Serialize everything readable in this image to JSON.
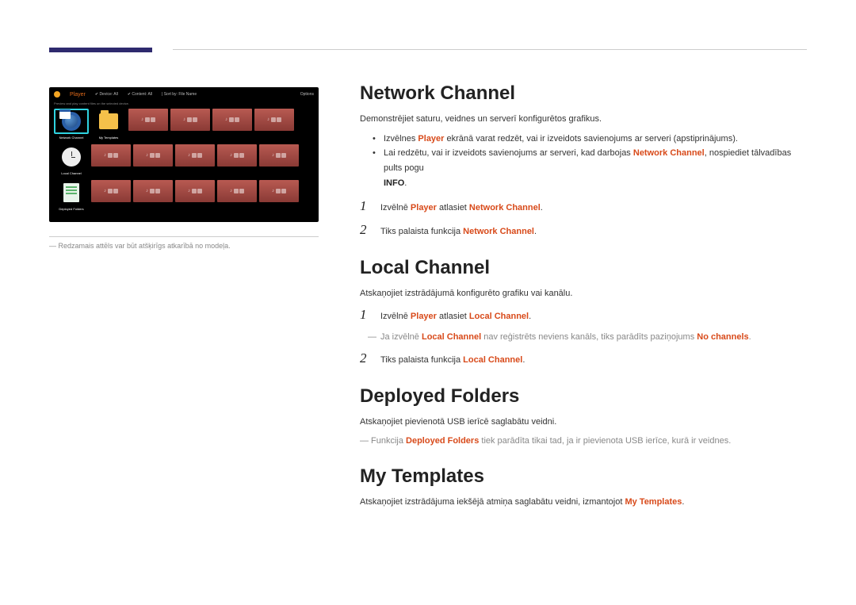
{
  "player_ui": {
    "title": "Player",
    "filter_device_label": "Device",
    "filter_device_value": "All",
    "filter_content_label": "Content",
    "filter_content_value": "All",
    "sort_label": "Sort by",
    "sort_value": "File Name",
    "options": "Options",
    "subtitle": "Preview and play content files on the selected device.",
    "tiles": {
      "network_channel": "Network Channel",
      "my_templates": "My Templates",
      "local_channel": "Local Channel",
      "deployed_folders": "Deployed Folders"
    }
  },
  "left_note": "Redzamais attēls var būt atšķirīgs atkarībā no modeļa.",
  "sections": {
    "network": {
      "heading": "Network Channel",
      "intro": "Demonstrējiet saturu, veidnes un serverī konfigurētos grafikus.",
      "bullet1_a": "Izvēlnes ",
      "bullet1_b": "Player",
      "bullet1_c": " ekrānā varat redzēt, vai ir izveidots savienojums ar serveri (apstiprinājums).",
      "bullet2_a": "Lai redzētu, vai ir izveidots savienojums ar serveri, kad darbojas ",
      "bullet2_b": "Network Channel",
      "bullet2_c": ", nospiediet tālvadības pults pogu ",
      "bullet2_d": "INFO",
      "bullet2_e": ".",
      "step1_a": "Izvēlnē ",
      "step1_b": "Player",
      "step1_c": " atlasiet ",
      "step1_d": "Network Channel",
      "step1_e": ".",
      "step2_a": "Tiks palaista funkcija ",
      "step2_b": "Network Channel",
      "step2_c": "."
    },
    "local": {
      "heading": "Local Channel",
      "intro": "Atskaņojiet izstrādājumā konfigurēto grafiku vai kanālu.",
      "step1_a": "Izvēlnē ",
      "step1_b": "Player",
      "step1_c": " atlasiet ",
      "step1_d": "Local Channel",
      "step1_e": ".",
      "dash_a": "Ja izvēlnē ",
      "dash_b": "Local Channel",
      "dash_c": " nav reģistrēts neviens kanāls, tiks parādīts paziņojums ",
      "dash_d": "No channels",
      "dash_e": ".",
      "step2_a": "Tiks palaista funkcija ",
      "step2_b": "Local Channel",
      "step2_c": "."
    },
    "deployed": {
      "heading": "Deployed Folders",
      "intro": "Atskaņojiet pievienotā USB ierīcē saglabātu veidni.",
      "dash_a": "Funkcija ",
      "dash_b": "Deployed Folders",
      "dash_c": " tiek parādīta tikai tad, ja ir pievienota USB ierīce, kurā ir veidnes."
    },
    "templates": {
      "heading": "My Templates",
      "intro_a": "Atskaņojiet izstrādājuma iekšējā atmiņa saglabātu veidni, izmantojot ",
      "intro_b": "My Templates",
      "intro_c": "."
    }
  },
  "nums": {
    "one": "1",
    "two": "2"
  }
}
